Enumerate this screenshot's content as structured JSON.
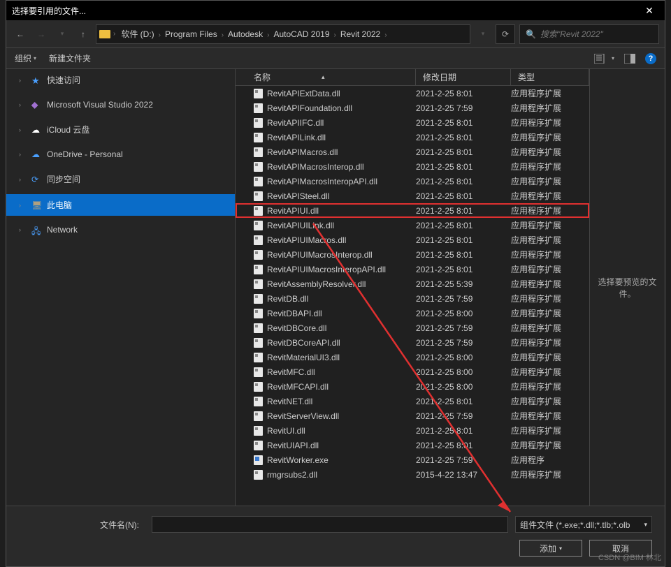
{
  "title": "选择要引用的文件...",
  "path": [
    "软件 (D:)",
    "Program Files",
    "Autodesk",
    "AutoCAD 2019",
    "Revit 2022"
  ],
  "search_placeholder": "搜索\"Revit 2022\"",
  "toolbar": {
    "organize": "组织",
    "newfolder": "新建文件夹"
  },
  "sidebar": [
    {
      "icon": "star",
      "label": "快速访问",
      "expandable": true
    },
    {
      "icon": "vs",
      "label": "Microsoft Visual Studio 2022",
      "expandable": true
    },
    {
      "icon": "cloud",
      "label": "iCloud 云盘",
      "expandable": true
    },
    {
      "icon": "od",
      "label": "OneDrive - Personal",
      "expandable": true
    },
    {
      "icon": "sync",
      "label": "同步空间",
      "expandable": true
    },
    {
      "icon": "pc",
      "label": "此电脑",
      "expandable": true,
      "selected": true
    },
    {
      "icon": "net",
      "label": "Network",
      "expandable": true
    }
  ],
  "columns": {
    "name": "名称",
    "date": "修改日期",
    "type": "类型"
  },
  "files": [
    {
      "name": "RevitAPIExtData.dll",
      "date": "2021-2-25 8:01",
      "type": "应用程序扩展"
    },
    {
      "name": "RevitAPIFoundation.dll",
      "date": "2021-2-25 7:59",
      "type": "应用程序扩展"
    },
    {
      "name": "RevitAPIIFC.dll",
      "date": "2021-2-25 8:01",
      "type": "应用程序扩展"
    },
    {
      "name": "RevitAPILink.dll",
      "date": "2021-2-25 8:01",
      "type": "应用程序扩展"
    },
    {
      "name": "RevitAPIMacros.dll",
      "date": "2021-2-25 8:01",
      "type": "应用程序扩展"
    },
    {
      "name": "RevitAPIMacrosInterop.dll",
      "date": "2021-2-25 8:01",
      "type": "应用程序扩展"
    },
    {
      "name": "RevitAPIMacrosInteropAPI.dll",
      "date": "2021-2-25 8:01",
      "type": "应用程序扩展"
    },
    {
      "name": "RevitAPISteel.dll",
      "date": "2021-2-25 8:01",
      "type": "应用程序扩展"
    },
    {
      "name": "RevitAPIUI.dll",
      "date": "2021-2-25 8:01",
      "type": "应用程序扩展",
      "highlight": true
    },
    {
      "name": "RevitAPIUILink.dll",
      "date": "2021-2-25 8:01",
      "type": "应用程序扩展"
    },
    {
      "name": "RevitAPIUIMacros.dll",
      "date": "2021-2-25 8:01",
      "type": "应用程序扩展"
    },
    {
      "name": "RevitAPIUIMacrosInterop.dll",
      "date": "2021-2-25 8:01",
      "type": "应用程序扩展"
    },
    {
      "name": "RevitAPIUIMacrosInteropAPI.dll",
      "date": "2021-2-25 8:01",
      "type": "应用程序扩展"
    },
    {
      "name": "RevitAssemblyResolver.dll",
      "date": "2021-2-25 5:39",
      "type": "应用程序扩展"
    },
    {
      "name": "RevitDB.dll",
      "date": "2021-2-25 7:59",
      "type": "应用程序扩展"
    },
    {
      "name": "RevitDBAPI.dll",
      "date": "2021-2-25 8:00",
      "type": "应用程序扩展"
    },
    {
      "name": "RevitDBCore.dll",
      "date": "2021-2-25 7:59",
      "type": "应用程序扩展"
    },
    {
      "name": "RevitDBCoreAPI.dll",
      "date": "2021-2-25 7:59",
      "type": "应用程序扩展"
    },
    {
      "name": "RevitMaterialUI3.dll",
      "date": "2021-2-25 8:00",
      "type": "应用程序扩展"
    },
    {
      "name": "RevitMFC.dll",
      "date": "2021-2-25 8:00",
      "type": "应用程序扩展"
    },
    {
      "name": "RevitMFCAPI.dll",
      "date": "2021-2-25 8:00",
      "type": "应用程序扩展"
    },
    {
      "name": "RevitNET.dll",
      "date": "2021-2-25 8:01",
      "type": "应用程序扩展"
    },
    {
      "name": "RevitServerView.dll",
      "date": "2021-2-25 7:59",
      "type": "应用程序扩展"
    },
    {
      "name": "RevitUI.dll",
      "date": "2021-2-25 8:01",
      "type": "应用程序扩展"
    },
    {
      "name": "RevitUIAPI.dll",
      "date": "2021-2-25 8:01",
      "type": "应用程序扩展"
    },
    {
      "name": "RevitWorker.exe",
      "date": "2021-2-25 7:59",
      "type": "应用程序",
      "icon": "exe"
    },
    {
      "name": "rmgrsubs2.dll",
      "date": "2015-4-22 13:47",
      "type": "应用程序扩展"
    }
  ],
  "preview_msg": "选择要预览的文件。",
  "filename_label": "文件名(N):",
  "filetype_value": "组件文件 (*.exe;*.dll;*.tlb;*.olb",
  "buttons": {
    "add": "添加",
    "cancel": "取消"
  },
  "watermark": "CSDN @BIM 林北"
}
